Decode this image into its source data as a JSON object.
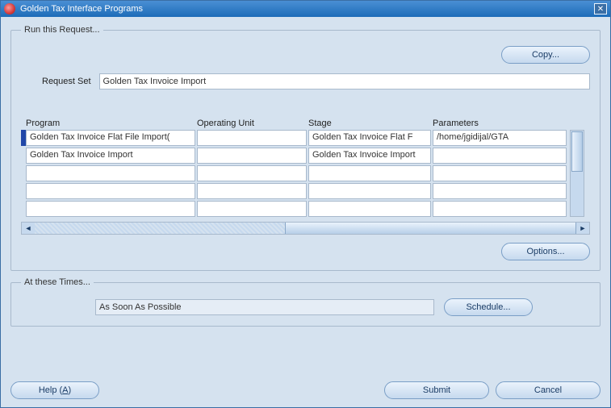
{
  "window": {
    "title": "Golden Tax Interface Programs"
  },
  "request": {
    "legend": "Run this Request...",
    "copy_label": "Copy...",
    "request_set_label": "Request Set",
    "request_set_value": "Golden Tax Invoice Import",
    "columns": {
      "program": "Program",
      "operating_unit": "Operating Unit",
      "stage": "Stage",
      "parameters": "Parameters"
    },
    "rows": [
      {
        "program": "Golden Tax Invoice Flat File Import(",
        "operating_unit": "",
        "stage": "Golden Tax Invoice Flat F",
        "parameters": "/home/jgidijal/GTA"
      },
      {
        "program": "Golden Tax Invoice Import",
        "operating_unit": "",
        "stage": "Golden Tax Invoice Import",
        "parameters": ""
      },
      {
        "program": "",
        "operating_unit": "",
        "stage": "",
        "parameters": ""
      },
      {
        "program": "",
        "operating_unit": "",
        "stage": "",
        "parameters": ""
      },
      {
        "program": "",
        "operating_unit": "",
        "stage": "",
        "parameters": ""
      }
    ],
    "options_label": "Options..."
  },
  "times": {
    "legend": "At these Times...",
    "value": "As Soon As Possible",
    "schedule_label": "Schedule..."
  },
  "buttons": {
    "help": "Help (",
    "help_mnemonic": "A",
    "help_suffix": ")",
    "submit": "Submit",
    "cancel": "Cancel"
  }
}
